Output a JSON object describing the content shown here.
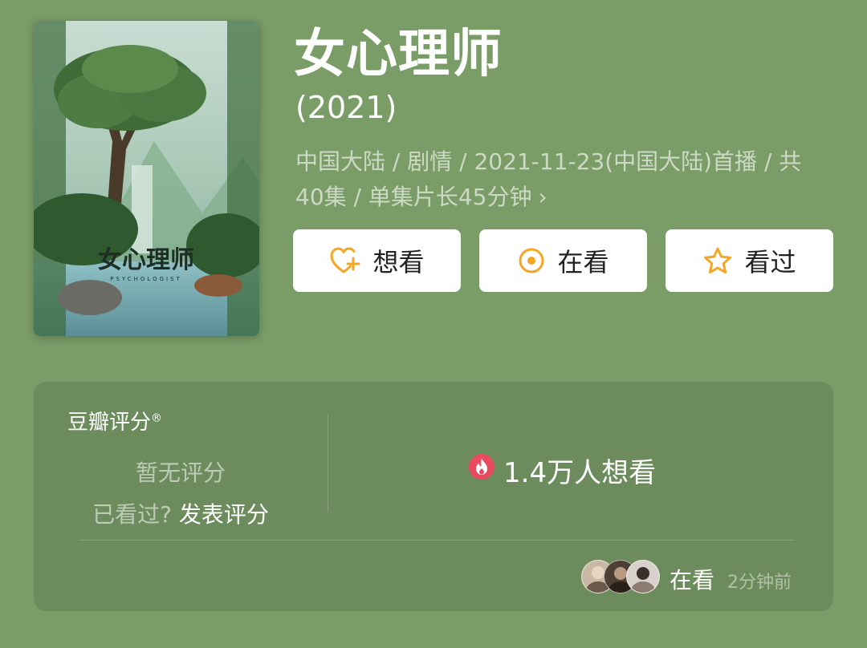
{
  "movie": {
    "title": "女心理师",
    "year": "(2021)",
    "meta_line1": "中国大陆 / 剧情 / 2021-11-23(中国大陆)首播 / 共",
    "meta_line2": "40集 / 单集片长45分钟",
    "chevron": "›"
  },
  "poster": {
    "title_text": "女心理师",
    "subtitle_text": "PSYCHOLOGIST"
  },
  "actions": [
    {
      "label": "想看",
      "icon": "heart-plus-icon"
    },
    {
      "label": "在看",
      "icon": "target-icon"
    },
    {
      "label": "看过",
      "icon": "star-icon"
    }
  ],
  "rating": {
    "title": "豆瓣评分",
    "registered": "®",
    "no_rating": "暂无评分",
    "seen_question": "已看过?",
    "rate_link": "发表评分",
    "want_count": "1.4万人想看"
  },
  "activity": {
    "status": "在看",
    "time_ago": "2分钟前"
  },
  "colors": {
    "background": "#7a9c67",
    "panel": "#6d8c5d",
    "accent_orange": "#f5a623",
    "hot_red": "#e84a5f"
  }
}
